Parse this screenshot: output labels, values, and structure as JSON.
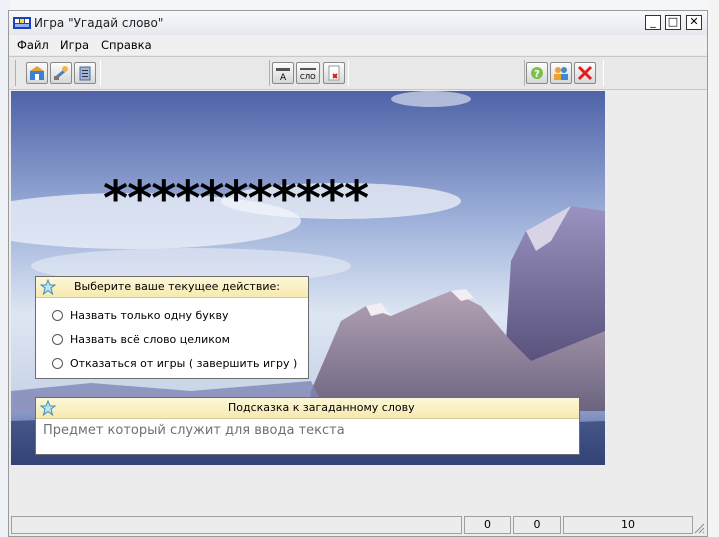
{
  "window": {
    "title": "Игра \"Угадай слово\"",
    "controls": {
      "minimize": "_",
      "maximize": "□",
      "close": "✕"
    }
  },
  "menu": [
    "Файл",
    "Игра",
    "Справка"
  ],
  "toolbar": {
    "group1": [
      "new-game-icon",
      "tools-icon",
      "clipboard-icon"
    ],
    "group2": [
      "letter-a-icon",
      "word-icon",
      "delete-icon"
    ],
    "group3": [
      "hint-icon",
      "players-icon",
      "exit-icon"
    ],
    "letter_glyph": "A",
    "word_glyph": "СЛО"
  },
  "game": {
    "hidden_word": "***********"
  },
  "action_panel": {
    "title": "Выберите ваше текущее действие:",
    "options": [
      "Назвать только одну букву",
      "Назвать всё слово целиком",
      "Отказаться от игры ( завершить игру )"
    ]
  },
  "hint_panel": {
    "title": "Подсказка к загаданному слову",
    "text": "Предмет который служит для ввода текста"
  },
  "status": {
    "left": "",
    "values": [
      "0",
      "0",
      "10"
    ]
  },
  "colors": {
    "panel_header": "#f6e9b0",
    "sky_top": "#5d6fb0",
    "sky_light": "#d9e3f1",
    "mountain": "#5b5486"
  }
}
